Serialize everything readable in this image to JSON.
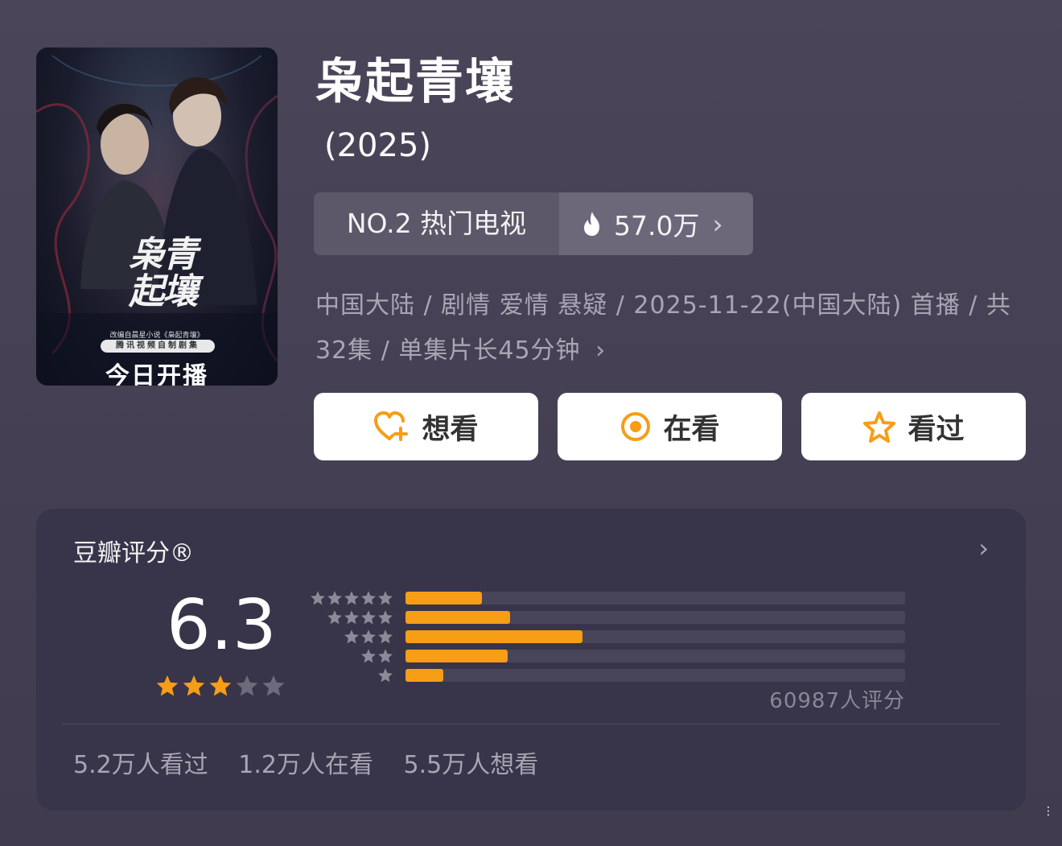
{
  "poster": {
    "calligraphy": "枭青起壤",
    "small_text": "改编自晨星小说《枭起青壤》",
    "pill_text": "腾讯视频自制剧集",
    "today_text": "今日开播"
  },
  "title": "枭起青壤",
  "year": "(2025)",
  "rank": {
    "label": "NO.2 热门电视",
    "hot_value": "57.0万",
    "chevron": "›"
  },
  "meta": {
    "text": "中国大陆 / 剧情 爱情 悬疑 / 2025-11-22(中国大陆) 首播 / 共32集 / 单集片长45分钟",
    "chevron": "›"
  },
  "actions": [
    {
      "label": "想看",
      "icon": "heart-plus-icon"
    },
    {
      "label": "在看",
      "icon": "target-circle-icon"
    },
    {
      "label": "看过",
      "icon": "star-outline-icon"
    }
  ],
  "rating": {
    "header": "豆瓣评分®",
    "arrow": "›",
    "score": "6.3",
    "stars_filled": 3,
    "stars_total": 5,
    "distribution": [
      {
        "stars": 5,
        "fraction": 0.153
      },
      {
        "stars": 4,
        "fraction": 0.21
      },
      {
        "stars": 3,
        "fraction": 0.355
      },
      {
        "stars": 2,
        "fraction": 0.205
      },
      {
        "stars": 1,
        "fraction": 0.075
      }
    ],
    "count": "60987人评分",
    "stats": [
      "5.2万人看过",
      "1.2万人在看",
      "5.5万人想看"
    ]
  },
  "colors": {
    "accent": "#f79d16",
    "background": "#4a4558",
    "card": "#38344a"
  },
  "corner_glyph": "⋮"
}
